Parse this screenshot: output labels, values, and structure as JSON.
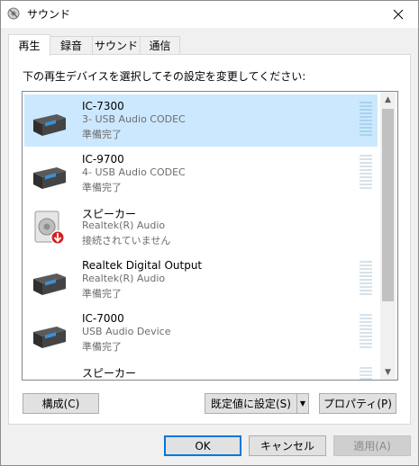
{
  "window": {
    "title": "サウンド"
  },
  "tabs": [
    {
      "label": "再生",
      "active": true
    },
    {
      "label": "録音",
      "active": false
    },
    {
      "label": "サウンド",
      "active": false
    },
    {
      "label": "通信",
      "active": false
    }
  ],
  "playback": {
    "instruction": "下の再生デバイスを選択してその設定を変更してください:",
    "devices": [
      {
        "name": "IC-7300",
        "description": "3- USB Audio CODEC",
        "status": "準備完了",
        "icon": "usb-audio-device-icon",
        "selected": true
      },
      {
        "name": "IC-9700",
        "description": "4- USB Audio CODEC",
        "status": "準備完了",
        "icon": "usb-audio-device-icon",
        "selected": false
      },
      {
        "name": "スピーカー",
        "description": "Realtek(R) Audio",
        "status": "接続されていません",
        "icon": "speaker-disconnected-icon",
        "selected": false
      },
      {
        "name": "Realtek Digital Output",
        "description": "Realtek(R) Audio",
        "status": "準備完了",
        "icon": "usb-audio-device-icon",
        "selected": false
      },
      {
        "name": "IC-7000",
        "description": "USB Audio Device",
        "status": "準備完了",
        "icon": "usb-audio-device-icon",
        "selected": false
      },
      {
        "name": "スピーカー",
        "description": "",
        "status": "",
        "icon": "usb-audio-device-icon",
        "selected": false
      }
    ],
    "configure_label": "構成(C)",
    "set_default_label": "既定値に設定(S)",
    "properties_label": "プロパティ(P)"
  },
  "footer": {
    "ok_label": "OK",
    "cancel_label": "キャンセル",
    "apply_label": "適用(A)"
  },
  "colors": {
    "selection": "#cce8ff",
    "default_border": "#0078d7",
    "meter_green": "#3cb371"
  }
}
